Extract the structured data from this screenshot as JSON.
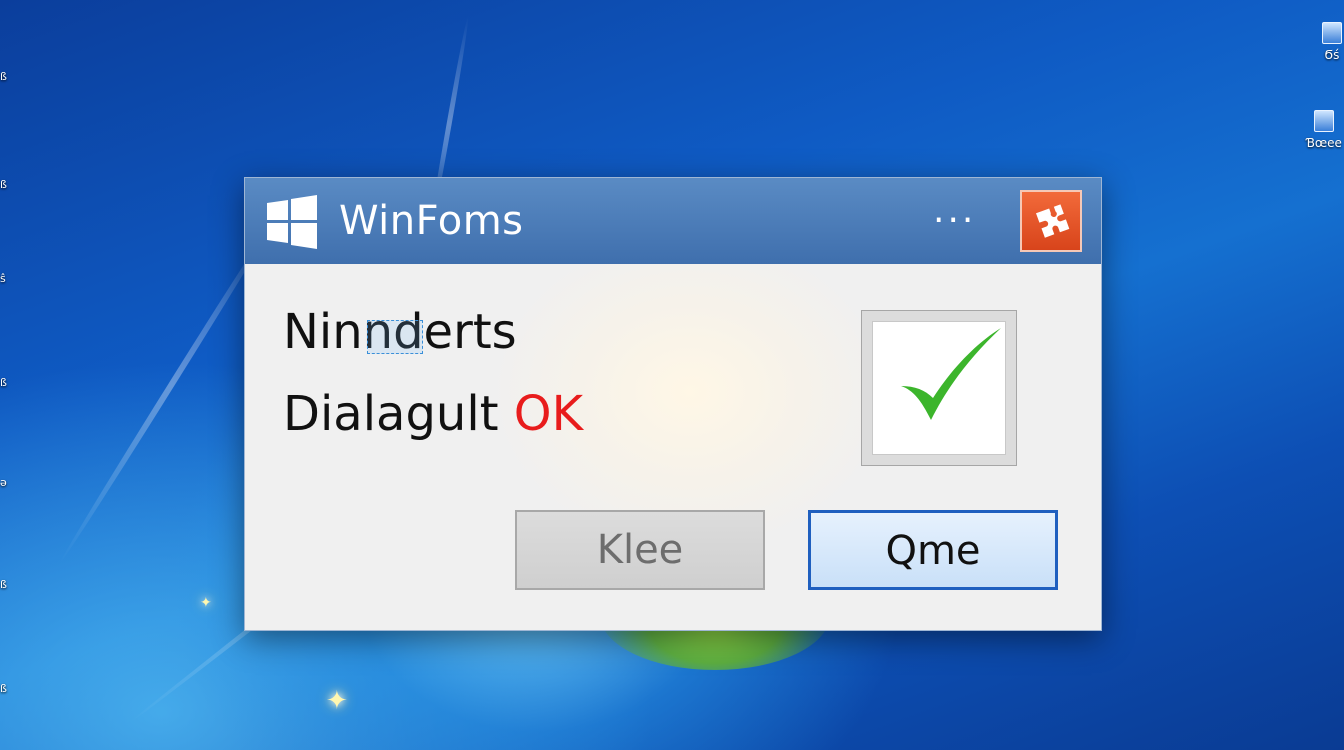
{
  "desktop": {
    "right_icons": [
      {
        "label": "Ϭś"
      },
      {
        "label": "Ɓœee"
      }
    ]
  },
  "dialog": {
    "title": "WinFoms",
    "more_glyph": "···",
    "message_line1": "Ninnderts",
    "message_line2_text": "Dialagult",
    "message_line2_highlight": "OK",
    "secondary_button": "Klee",
    "primary_button": "Qme",
    "colors": {
      "titlebar": "#4a7bbd",
      "close": "#e2532a",
      "highlight_text": "#e81c1c",
      "check": "#3cb52c",
      "primary_border": "#1f5fbf"
    }
  }
}
